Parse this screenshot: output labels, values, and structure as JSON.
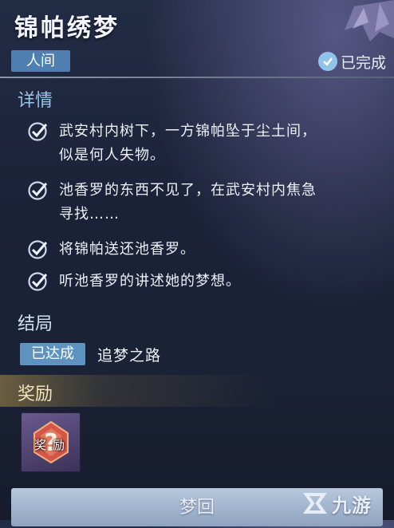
{
  "quest": {
    "title": "锦帕绣梦",
    "realm_tag": "人间",
    "status": "已完成"
  },
  "details": {
    "heading": "详情",
    "items": [
      {
        "line1": "武安村内树下，一方锦帕坠于尘土间，",
        "line2": "似是何人失物。"
      },
      {
        "line1": "池香罗的东西不见了，在武安村内焦急",
        "line2": "寻找……"
      },
      {
        "line1": "将锦帕送还池香罗。",
        "line2": ""
      },
      {
        "line1": "听池香罗的讲述她的梦想。",
        "line2": ""
      }
    ]
  },
  "ending": {
    "heading": "结局",
    "badge": "已达成",
    "name": "追梦之路"
  },
  "reward": {
    "heading": "奖励",
    "item_label": "奖励"
  },
  "bottom_button": "梦回",
  "watermark": "九游",
  "colors": {
    "accent_blue": "#9bc5ea",
    "tag_blue": "#4e7fb0",
    "check_blue": "#8fc3ea"
  }
}
